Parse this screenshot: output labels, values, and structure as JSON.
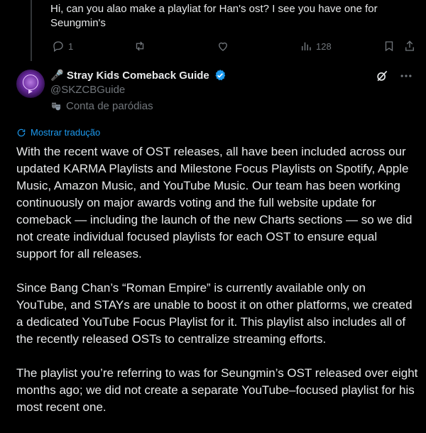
{
  "reply": {
    "text": "Hi, can you alao make a playliat for Han's ost? I see you have one for Seungmin's",
    "reply_count": "1",
    "views_count": "128"
  },
  "post": {
    "author_name": "🎤 Stray Kids Comeback Guide",
    "handle": "@SKZCBGuide",
    "parody_label": "Conta de paródias",
    "translate_label": "Mostrar tradução",
    "paragraphs": [
      "With the recent wave of OST releases, all have been included across our updated KARMA Playlists and Milestone Focus Playlists on Spotify, Apple Music, Amazon Music, and YouTube Music. Our team has been working continuously on major awards voting and the full website update for comeback — including the launch of the new Charts sections — so we did not create individual focused playlists for each OST to ensure equal support for all releases.",
      "Since Bang Chan’s “Roman Empire” is currently available only on YouTube, and STAYs are unable to boost it on other platforms, we created a dedicated YouTube Focus Playlist for it. This playlist also includes all of the recently released OSTs to centralize streaming efforts.",
      "The playlist you’re referring to was for Seungmin’s OST released over eight months ago; we did not create a separate YouTube–focused playlist for his most recent one."
    ]
  },
  "colors": {
    "background": "#000000",
    "text": "#e7e9ea",
    "muted": "#71767b",
    "link": "#1d9bf0",
    "verified": "#1d9bf0"
  }
}
